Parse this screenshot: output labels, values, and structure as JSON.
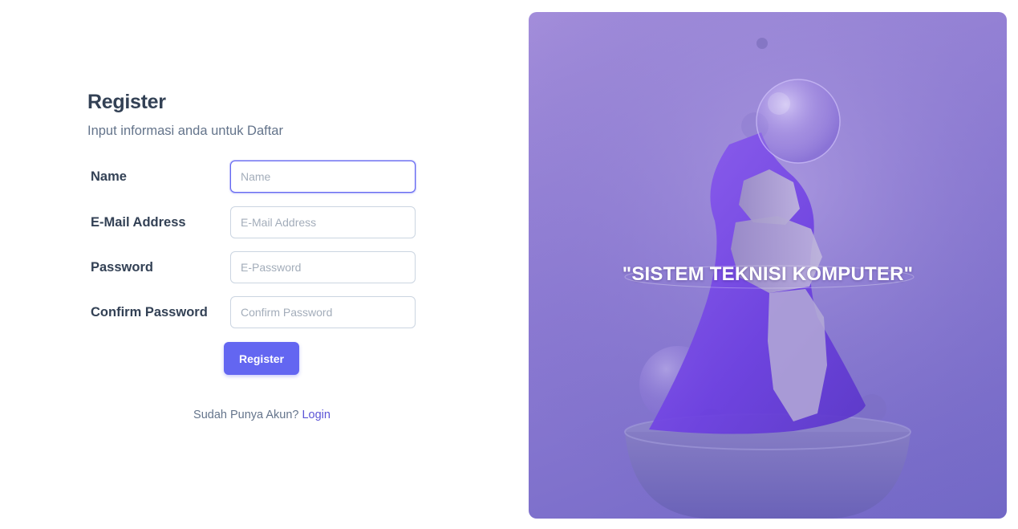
{
  "form": {
    "title": "Register",
    "subtitle": "Input informasi anda untuk Daftar",
    "fields": [
      {
        "label": "Name",
        "placeholder": "Name"
      },
      {
        "label": "E-Mail Address",
        "placeholder": "E-Mail Address"
      },
      {
        "label": "Password",
        "placeholder": "E-Password"
      },
      {
        "label": "Confirm Password",
        "placeholder": "Confirm Password"
      }
    ],
    "submit_label": "Register",
    "footer_text": "Sudah Punya Akun?",
    "login_link": "Login"
  },
  "panel": {
    "tagline": "\"SISTEM TEKNISI KOMPUTER\""
  },
  "colors": {
    "accent": "#6366f1",
    "panel_tint": "#8c7ad2",
    "heading": "#334155",
    "muted": "#64748b"
  }
}
